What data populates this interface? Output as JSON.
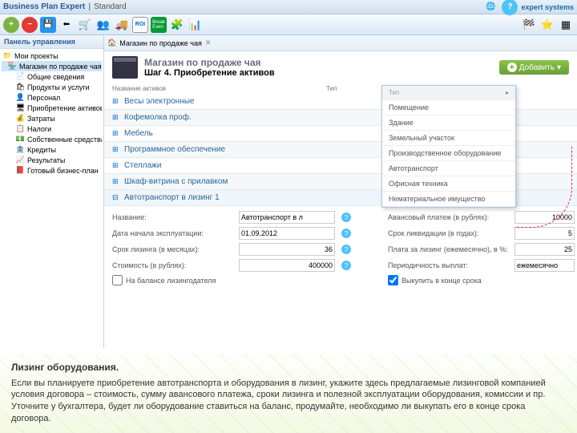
{
  "titlebar": {
    "app": "Business Plan Expert",
    "edition": "Standard",
    "brand": "expert systems"
  },
  "sidebar": {
    "header": "Панель управления",
    "root": "Мои проекты",
    "project": "Магазин по продаже чая",
    "items": [
      "Общие сведения",
      "Продукты и услуги",
      "Персонал",
      "Приобретение активов",
      "Затраты",
      "Налоги",
      "Собственные средства",
      "Кредиты",
      "Результаты",
      "Готовый бизнес-план"
    ]
  },
  "tab": "Магазин по продаже чая",
  "page": {
    "title": "Магазин по продаже чая",
    "step": "Шаг 4. Приобретение активов"
  },
  "addBtn": "Добавить",
  "subL": "Название активов",
  "subR": "Тип",
  "assets": [
    "Весы электронные",
    "Кофемолка проф.",
    "Мебель",
    "Программное обеспечение",
    "Стеллажи",
    "Шкаф-витрина с прилавком",
    "Автотранспорт в лизинг 1"
  ],
  "popup": {
    "hdr": "Тип",
    "items": [
      "Помещение",
      "Здание",
      "Земельный участок",
      "Производственное оборудование",
      "Автотранспорт",
      "Офисная техника",
      "Нематериальное имущество"
    ]
  },
  "form": {
    "f1l": "Название:",
    "f1v": "Автотранспорт в л",
    "f2l": "Авансовый платеж (в рублях):",
    "f2v": "10000",
    "f3l": "Дата начала эксплуатации:",
    "f3v": "01.09.2012",
    "f4l": "Срок ликвидации (в годах):",
    "f4v": "5",
    "f5l": "Срок лизинга (в месяцах):",
    "f5v": "36",
    "f6l": "Плата за лизинг (ежемесячно), в %:",
    "f6v": "25",
    "f7l": "Стоимость (в рублях):",
    "f7v": "400000",
    "f8l": "Периодичность выплат:",
    "f8v": "ежемесячно",
    "c1": "На балансе лизингодателя",
    "c2": "Выкупить в конце срока"
  },
  "footer": {
    "h": "Лизинг оборудования.",
    "p": "Если вы планируете приобретение автотранспорта и оборудования в лизинг, укажите здесь предлагаемые лизинговой компанией условия договора – стоимость, сумму авансового платежа, сроки лизинга и полезной эксплуатации оборудования, комиссии и пр. Уточните у бухгалтера, будет ли оборудование ставиться на баланс, продумайте, необходимо ли выкупать его в конце срока договора."
  }
}
